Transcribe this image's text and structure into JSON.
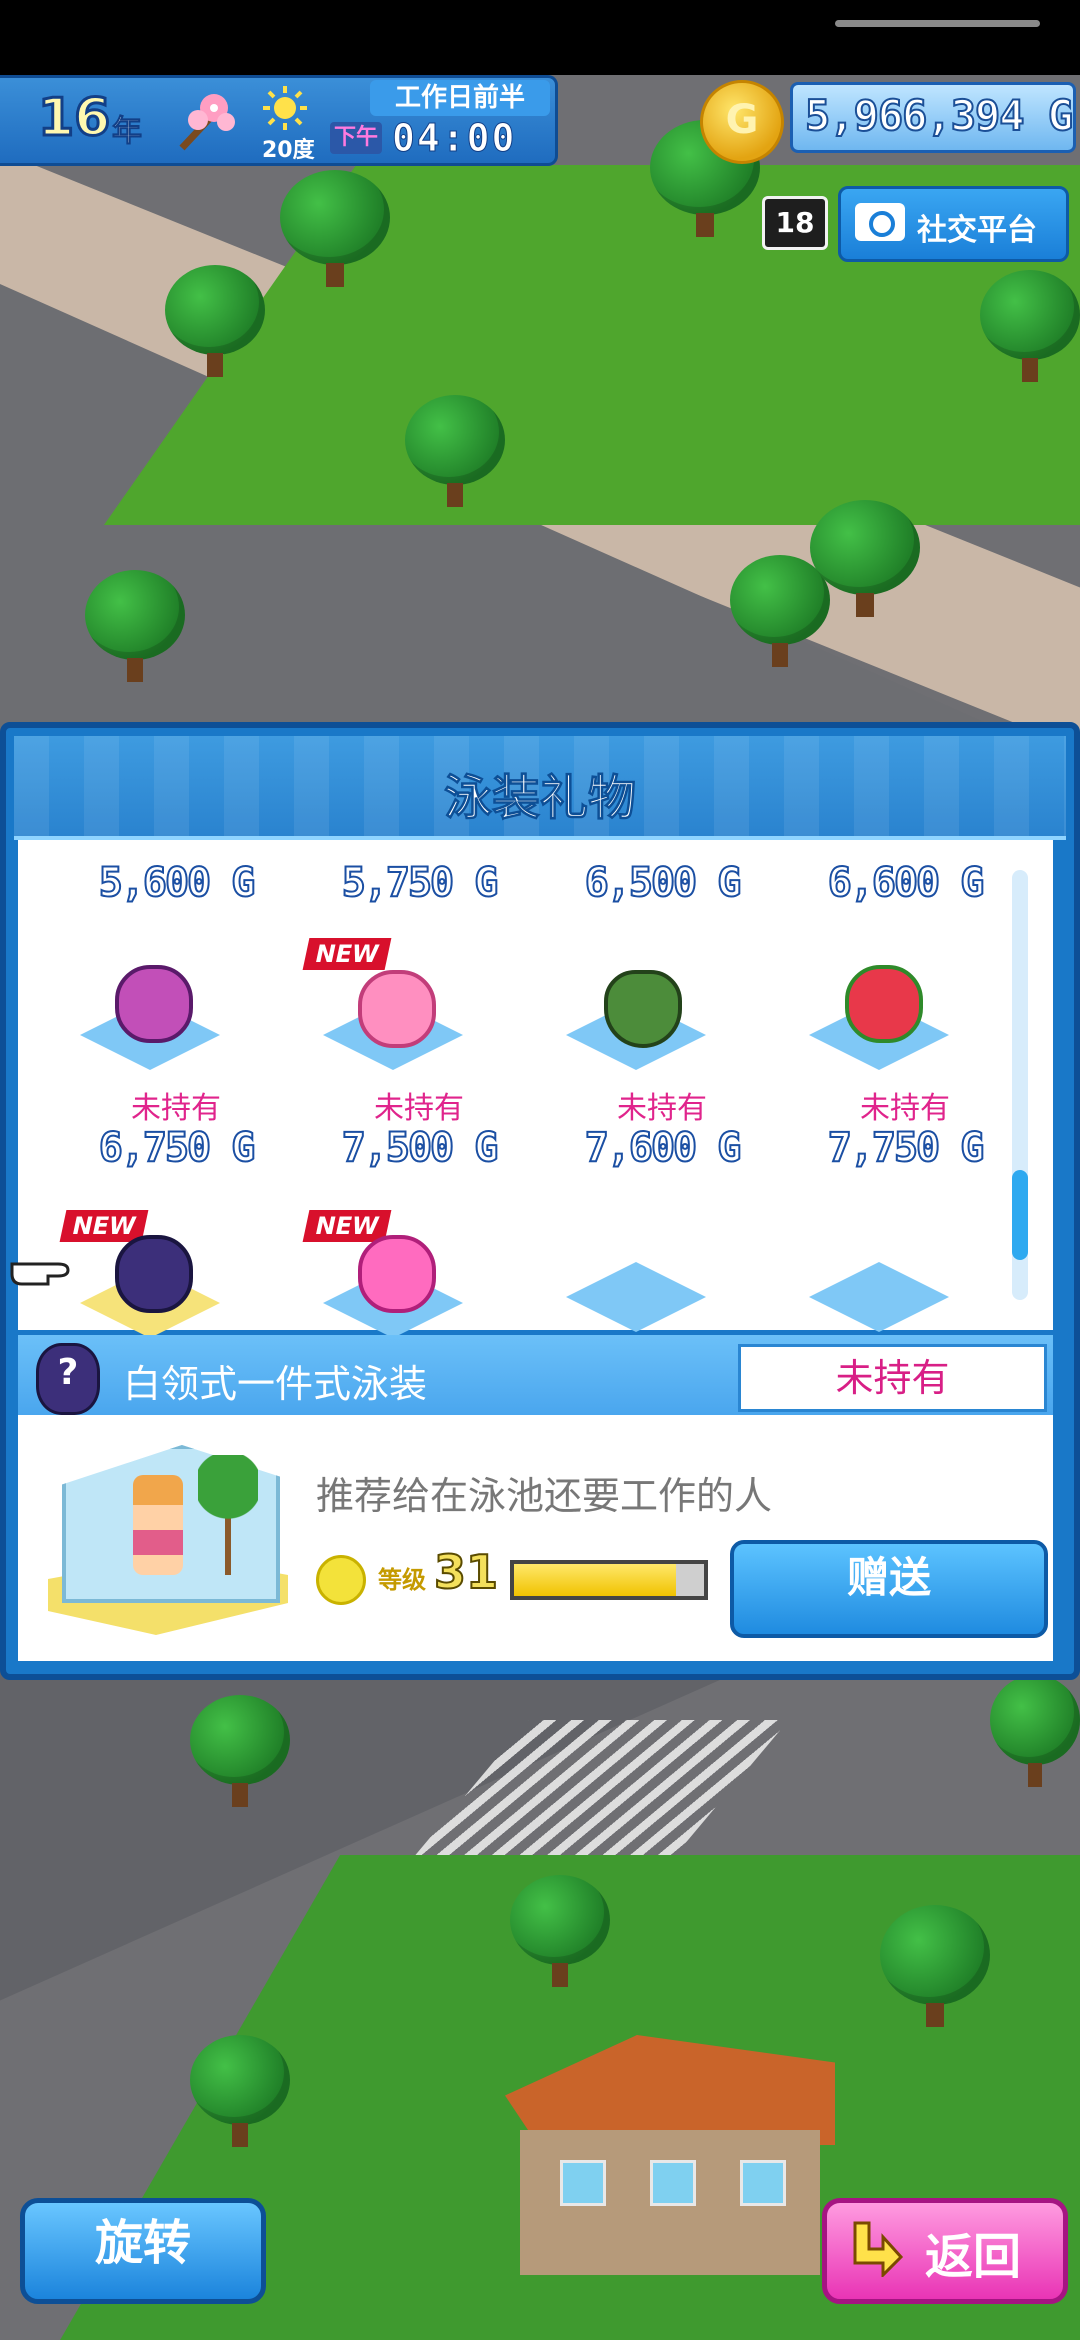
{
  "hud": {
    "year_number": "16",
    "year_label": "年",
    "temperature": "20度",
    "period": "工作日前半",
    "ampm": "下午",
    "time": "04:00",
    "money": "5,966,394 G",
    "age_rating": "18",
    "social_label": "社交平台"
  },
  "panel": {
    "title": "泳装礼物",
    "row1_prices": [
      "5,600 G",
      "5,750 G",
      "6,500 G",
      "6,600 G"
    ],
    "row2_status": [
      "未持有",
      "未持有",
      "未持有",
      "未持有"
    ],
    "row2_prices": [
      "6,750 G",
      "7,500 G",
      "7,600 G",
      "7,750 G"
    ],
    "new_badge": "NEW",
    "selected": {
      "name": "白领式一件式泳装",
      "status": "未持有",
      "description": "推荐给在泳池还要工作的人",
      "level_label": "等级",
      "level": "31",
      "level_progress": 0.85,
      "gift_label": "赠送"
    }
  },
  "buttons": {
    "rotate": "旋转",
    "back": "返回"
  },
  "colors": {
    "panel_blue": "#1978c8",
    "status_pink": "#e0248c"
  }
}
